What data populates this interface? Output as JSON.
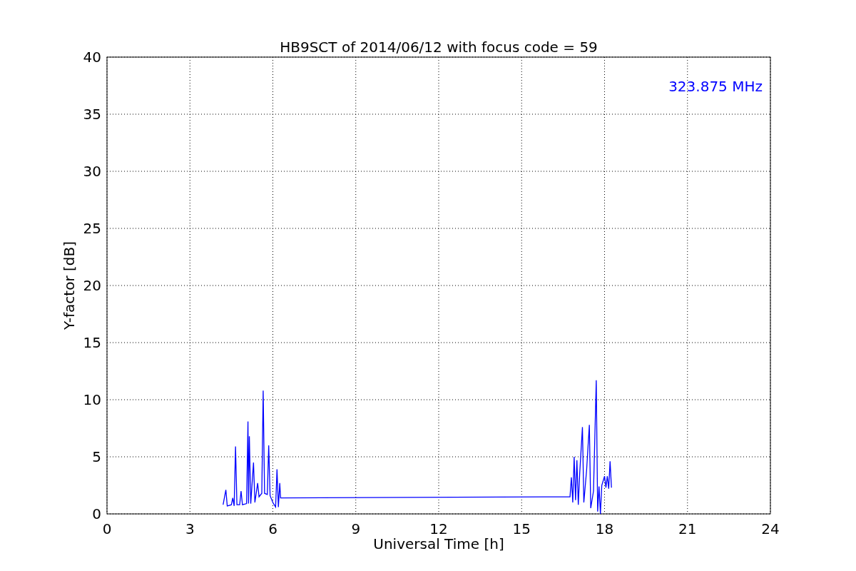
{
  "chart_data": {
    "type": "line",
    "title": "HB9SCT of 2014/06/12 with focus code = 59",
    "xlabel": "Universal Time [h]",
    "ylabel": "Y-factor [dB]",
    "x": [
      4.2,
      4.3,
      4.35,
      4.5,
      4.55,
      4.6,
      4.65,
      4.7,
      4.8,
      4.85,
      4.9,
      5.05,
      5.1,
      5.12,
      5.15,
      5.2,
      5.3,
      5.35,
      5.45,
      5.5,
      5.6,
      5.65,
      5.7,
      5.8,
      5.85,
      5.9,
      6.0,
      6.1,
      6.15,
      6.2,
      6.25,
      6.28,
      16.75,
      16.8,
      16.85,
      16.9,
      16.95,
      17.0,
      17.05,
      17.1,
      17.2,
      17.25,
      17.35,
      17.45,
      17.5,
      17.6,
      17.7,
      17.75,
      17.8,
      17.85,
      17.9,
      18.0,
      18.05,
      18.1,
      18.15,
      18.2,
      18.25
    ],
    "series": [
      {
        "name": "323.875 MHz",
        "color": "#0000ff",
        "values": [
          0.8,
          2.1,
          0.7,
          0.8,
          1.4,
          0.7,
          5.9,
          0.8,
          0.8,
          2.0,
          0.8,
          0.9,
          8.1,
          0.9,
          6.8,
          0.9,
          4.5,
          1.0,
          2.7,
          1.5,
          1.8,
          10.8,
          1.8,
          1.7,
          6.0,
          1.6,
          1.0,
          0.6,
          3.9,
          0.6,
          2.7,
          1.4,
          1.5,
          3.2,
          1.0,
          5.0,
          1.2,
          4.7,
          0.8,
          3.5,
          7.6,
          1.0,
          3.8,
          7.8,
          0.5,
          2.0,
          11.7,
          0.2,
          2.4,
          0.0,
          2.5,
          3.3,
          2.3,
          3.3,
          2.2,
          4.6,
          2.3
        ]
      }
    ],
    "xlim": [
      0,
      24
    ],
    "ylim": [
      0,
      40
    ],
    "xticks": [
      0,
      3,
      6,
      9,
      12,
      15,
      18,
      21,
      24
    ],
    "yticks": [
      0,
      5,
      10,
      15,
      20,
      25,
      30,
      35,
      40
    ],
    "grid": true
  }
}
